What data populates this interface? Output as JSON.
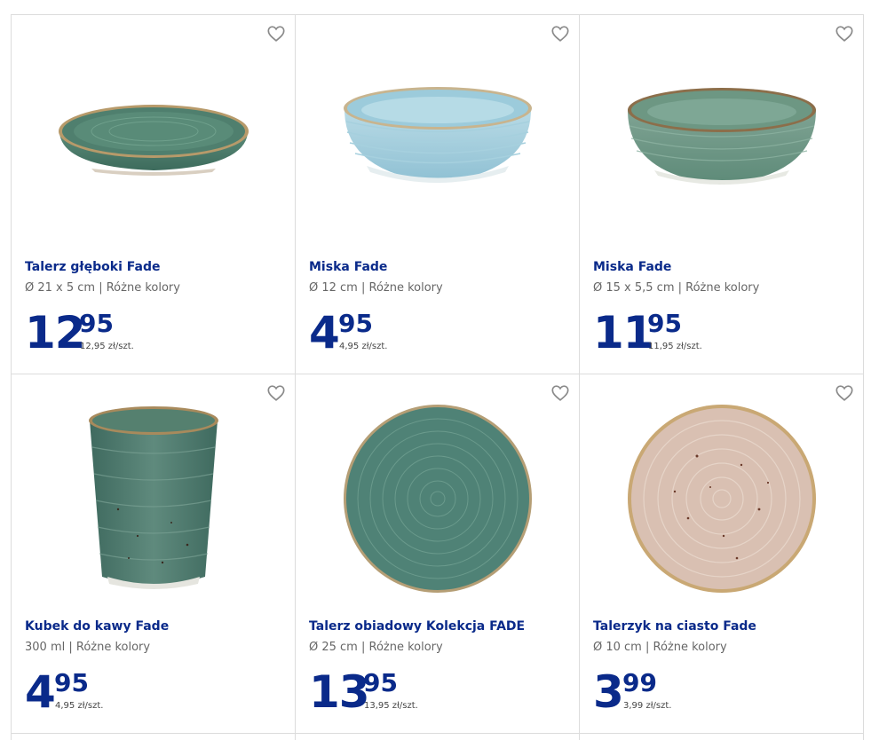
{
  "products": [
    {
      "title": "Talerz głęboki Fade",
      "subtitle": "Ø 21 x 5 cm | Różne kolory",
      "price_int": "12",
      "price_dec": "95",
      "unit_price": "12,95 zł/szt.",
      "image": "deep-plate-green"
    },
    {
      "title": "Miska Fade",
      "subtitle": "Ø 12 cm | Różne kolory",
      "price_int": "4",
      "price_dec": "95",
      "unit_price": "4,95 zł/szt.",
      "image": "bowl-light-blue"
    },
    {
      "title": "Miska Fade",
      "subtitle": "Ø 15 x 5,5 cm | Różne kolory",
      "price_int": "11",
      "price_dec": "95",
      "unit_price": "11,95 zł/szt.",
      "image": "bowl-green"
    },
    {
      "title": "Kubek do kawy Fade",
      "subtitle": "300 ml | Różne kolory",
      "price_int": "4",
      "price_dec": "95",
      "unit_price": "4,95 zł/szt.",
      "image": "mug-green"
    },
    {
      "title": "Talerz obiadowy Kolekcja FADE",
      "subtitle": "Ø 25 cm | Różne kolory",
      "price_int": "13",
      "price_dec": "95",
      "unit_price": "13,95 zł/szt.",
      "image": "dinner-plate-green"
    },
    {
      "title": "Talerzyk na ciasto Fade",
      "subtitle": "Ø 10 cm | Różne kolory",
      "price_int": "3",
      "price_dec": "99",
      "unit_price": "3,99 zł/szt.",
      "image": "cake-plate-beige"
    }
  ],
  "colors": {
    "brand_blue": "#0a2a8a",
    "border": "#dcdcdc",
    "heart": "#8a8a8a"
  },
  "icons": {
    "favorite": "heart-outline-icon"
  }
}
